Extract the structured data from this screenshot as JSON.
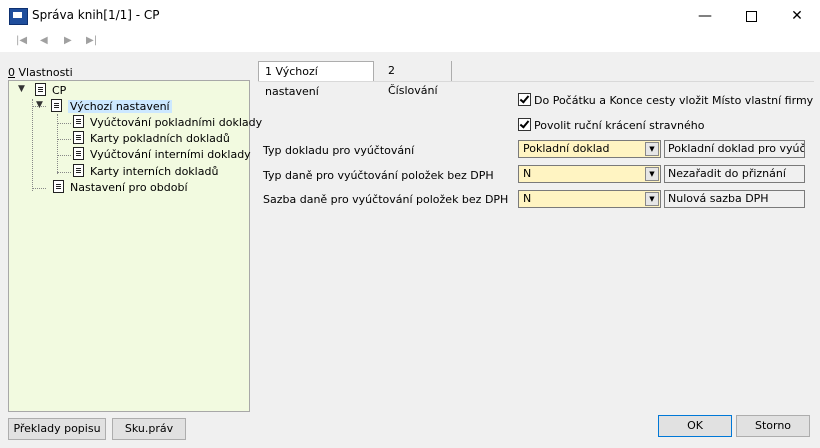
{
  "window": {
    "title": "Správa knih[1/1] - CP",
    "minimize": "—",
    "close": "✕"
  },
  "nav": {
    "first": "|◀",
    "prev": "◀",
    "next": "▶",
    "last": "▶|"
  },
  "left_panel": {
    "tab_number": "0",
    "tab_text": " Vlastnosti",
    "tree": {
      "root": "CP",
      "default": "Výchozí nastavení",
      "children": [
        "Vyúčtování pokladními doklady",
        "Karty pokladních dokladů",
        "Vyúčtování interními doklady",
        "Karty interních dokladů"
      ],
      "period": "Nastavení pro období"
    }
  },
  "tabs": [
    "1 Výchozí nastavení",
    "2 Číslování"
  ],
  "checkboxes": [
    {
      "label": "Do Počátku a Konce cesty vložit Místo vlastní firmy",
      "checked": true
    },
    {
      "label": "Povolit ruční krácení stravného",
      "checked": true
    }
  ],
  "fields": [
    {
      "label": "Typ dokladu pro vyúčtování",
      "value": "Pokladní doklad",
      "description": "Pokladní doklad pro vyúčtov",
      "highlight": "#fff4c2"
    },
    {
      "label": "Typ daně pro vyúčtování položek bez DPH",
      "value": "N",
      "description": "Nezařadit do přiznání",
      "highlight": "#fff4c2"
    },
    {
      "label": "Sazba daně pro vyúčtování položek bez DPH",
      "value": "N",
      "description": "Nulová sazba DPH",
      "highlight": "#fff4c2"
    }
  ],
  "buttons": {
    "translations": "Překlady popisu",
    "rights": "Sku.práv",
    "ok": "OK",
    "cancel": "Storno"
  },
  "colors": {
    "tree_bg": "#f2fae0",
    "selection": "#cce8ff",
    "primary_border": "#0078d7"
  }
}
